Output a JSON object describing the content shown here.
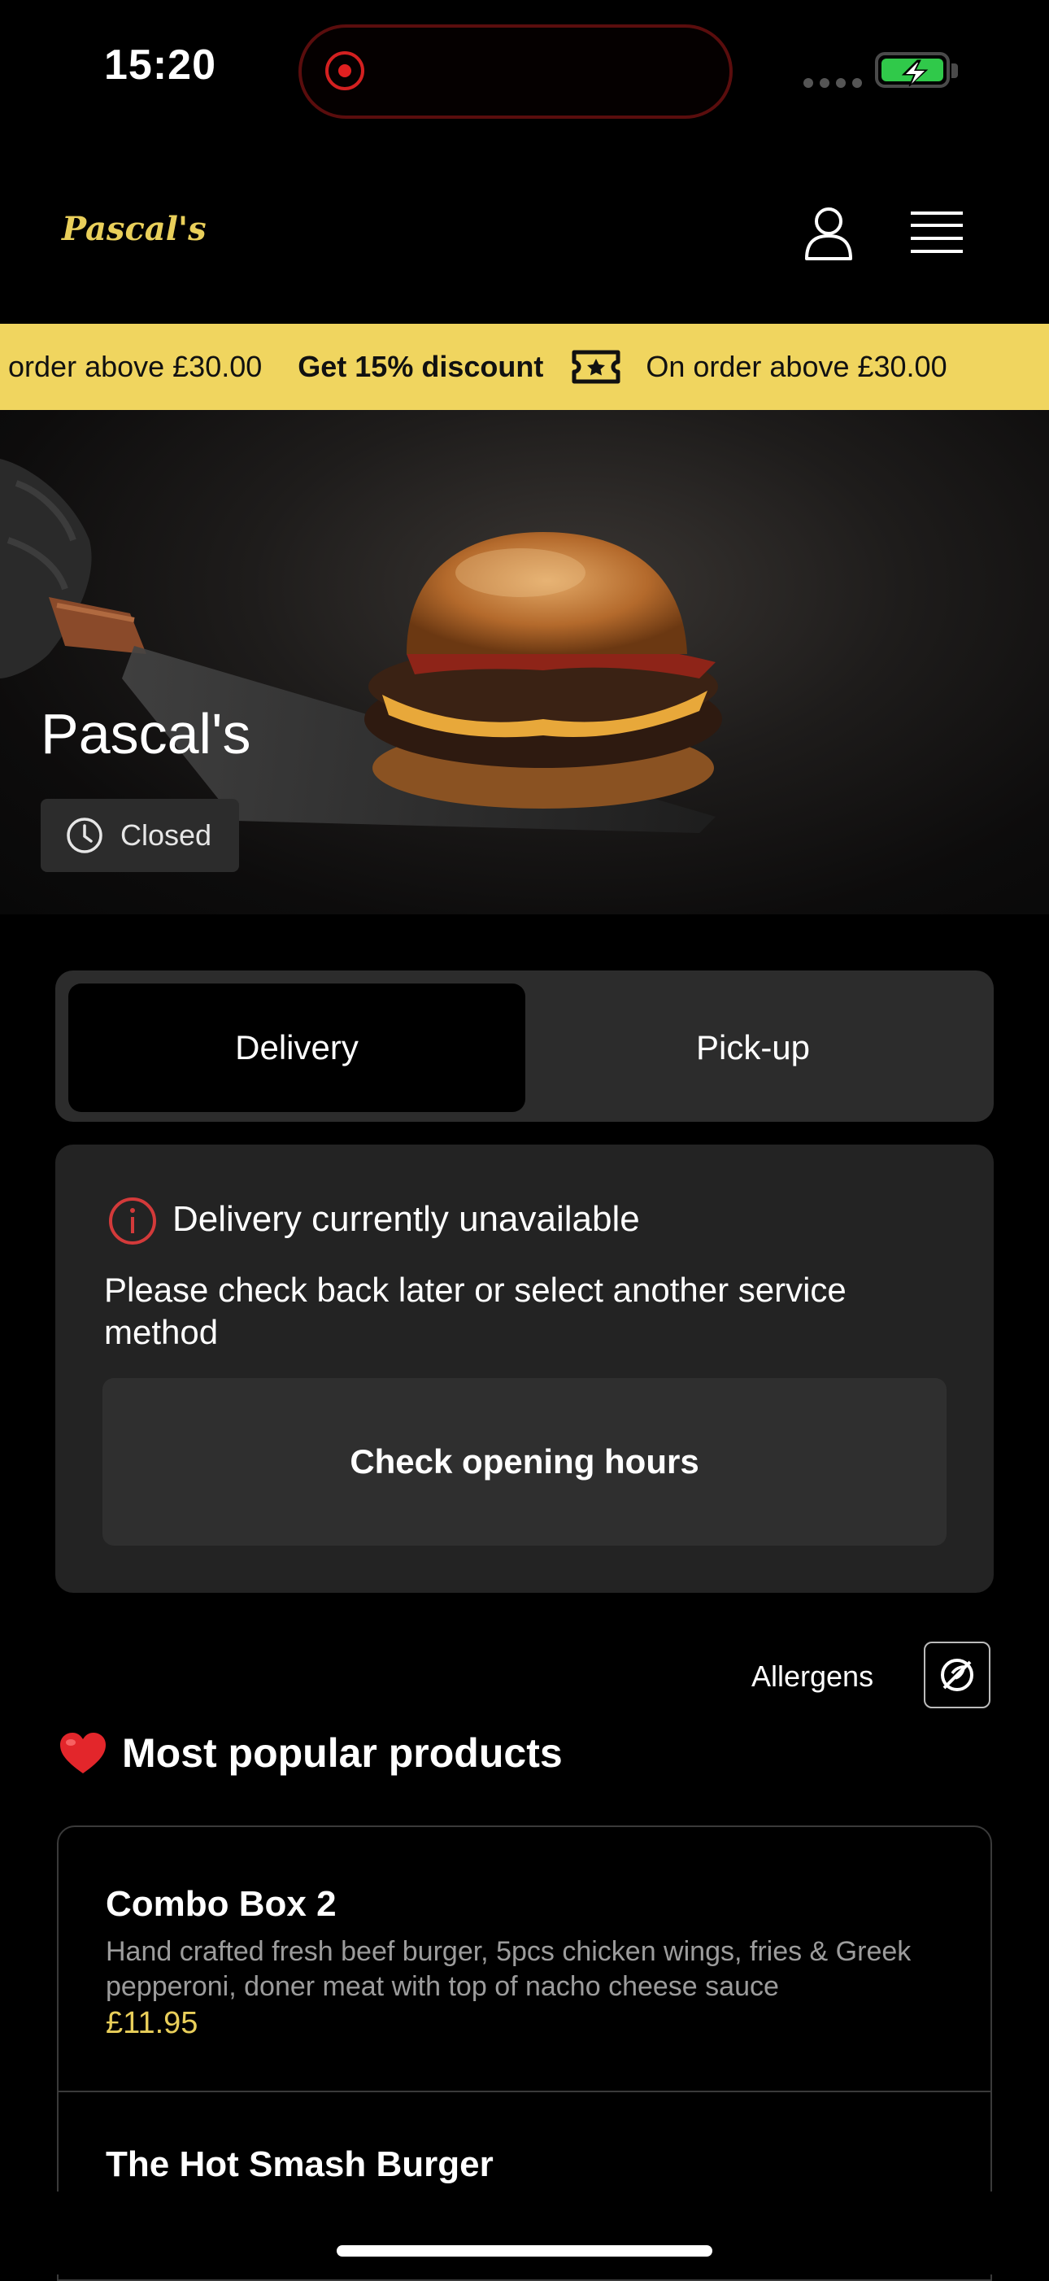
{
  "status_bar": {
    "time": "15:20"
  },
  "header": {
    "logo_text": "Pascal's",
    "account_icon": "user-icon",
    "menu_icon": "hamburger-menu-icon"
  },
  "promo": {
    "items": [
      {
        "text": "On order above £30.00",
        "bold": false
      },
      {
        "text": "Get 15% discount",
        "bold": true
      },
      {
        "text": "On order above £30.00",
        "bold": false
      }
    ],
    "icon": "ticket-star-icon",
    "background": "#f0d55f"
  },
  "hero": {
    "title": "Pascal's",
    "status_label": "Closed",
    "status_icon": "clock-icon"
  },
  "service_toggle": {
    "options": [
      "Delivery",
      "Pick-up"
    ],
    "selected": "Delivery"
  },
  "unavailable": {
    "title": "Delivery currently unavailable",
    "message": "Please check back later or select another service method",
    "button_label": "Check opening hours",
    "icon": "info-icon",
    "icon_color": "#d33a3a"
  },
  "allergens": {
    "label": "Allergens",
    "icon": "no-allergens-icon"
  },
  "popular": {
    "title": "Most popular products",
    "icon": "heart-icon",
    "products": [
      {
        "name": "Combo Box 2",
        "description": "Hand crafted fresh beef burger, 5pcs chicken wings, fries & Greek pepperoni, doner meat with top of nacho cheese sauce",
        "price": "£11.95"
      },
      {
        "name": "The Hot Smash Burger",
        "description": "",
        "price": ""
      }
    ]
  },
  "colors": {
    "accent": "#e9cf5a",
    "background": "#000000",
    "card": "#232323"
  }
}
